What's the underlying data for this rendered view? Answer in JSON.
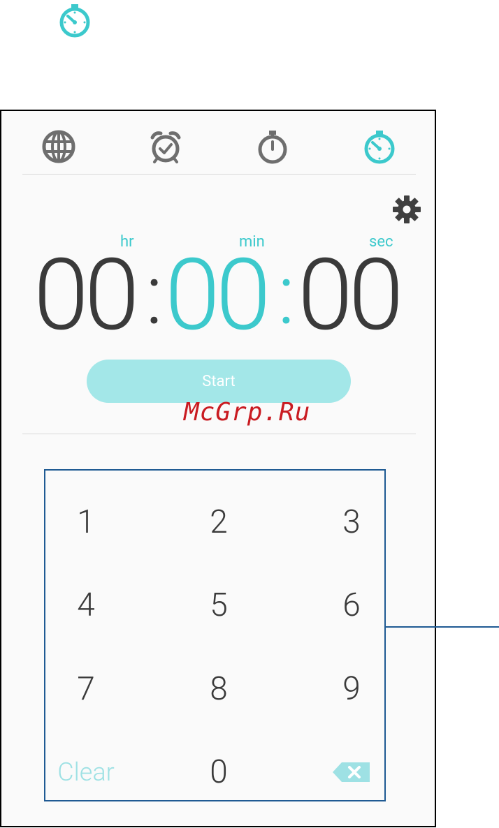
{
  "top_icon": "timer-icon",
  "tabs": [
    {
      "name": "world-clock",
      "icon": "globe-icon"
    },
    {
      "name": "alarm",
      "icon": "alarm-clock-icon"
    },
    {
      "name": "stopwatch",
      "icon": "stopwatch-icon"
    },
    {
      "name": "timer",
      "icon": "timer-icon",
      "active": true
    }
  ],
  "timer": {
    "hr_label": "hr",
    "min_label": "min",
    "sec_label": "sec",
    "hours": "00",
    "minutes": "00",
    "seconds": "00",
    "separator": ":"
  },
  "start_label": "Start",
  "watermark": "McGrp.Ru",
  "keypad": {
    "keys": [
      "1",
      "2",
      "3",
      "4",
      "5",
      "6",
      "7",
      "8",
      "9"
    ],
    "zero": "0",
    "clear": "Clear",
    "backspace_icon": "backspace-icon"
  },
  "colors": {
    "accent": "#3cc9cc",
    "start_button": "#a3e7e8",
    "digits": "#3a3a3a",
    "callout": "#1f5a93"
  }
}
